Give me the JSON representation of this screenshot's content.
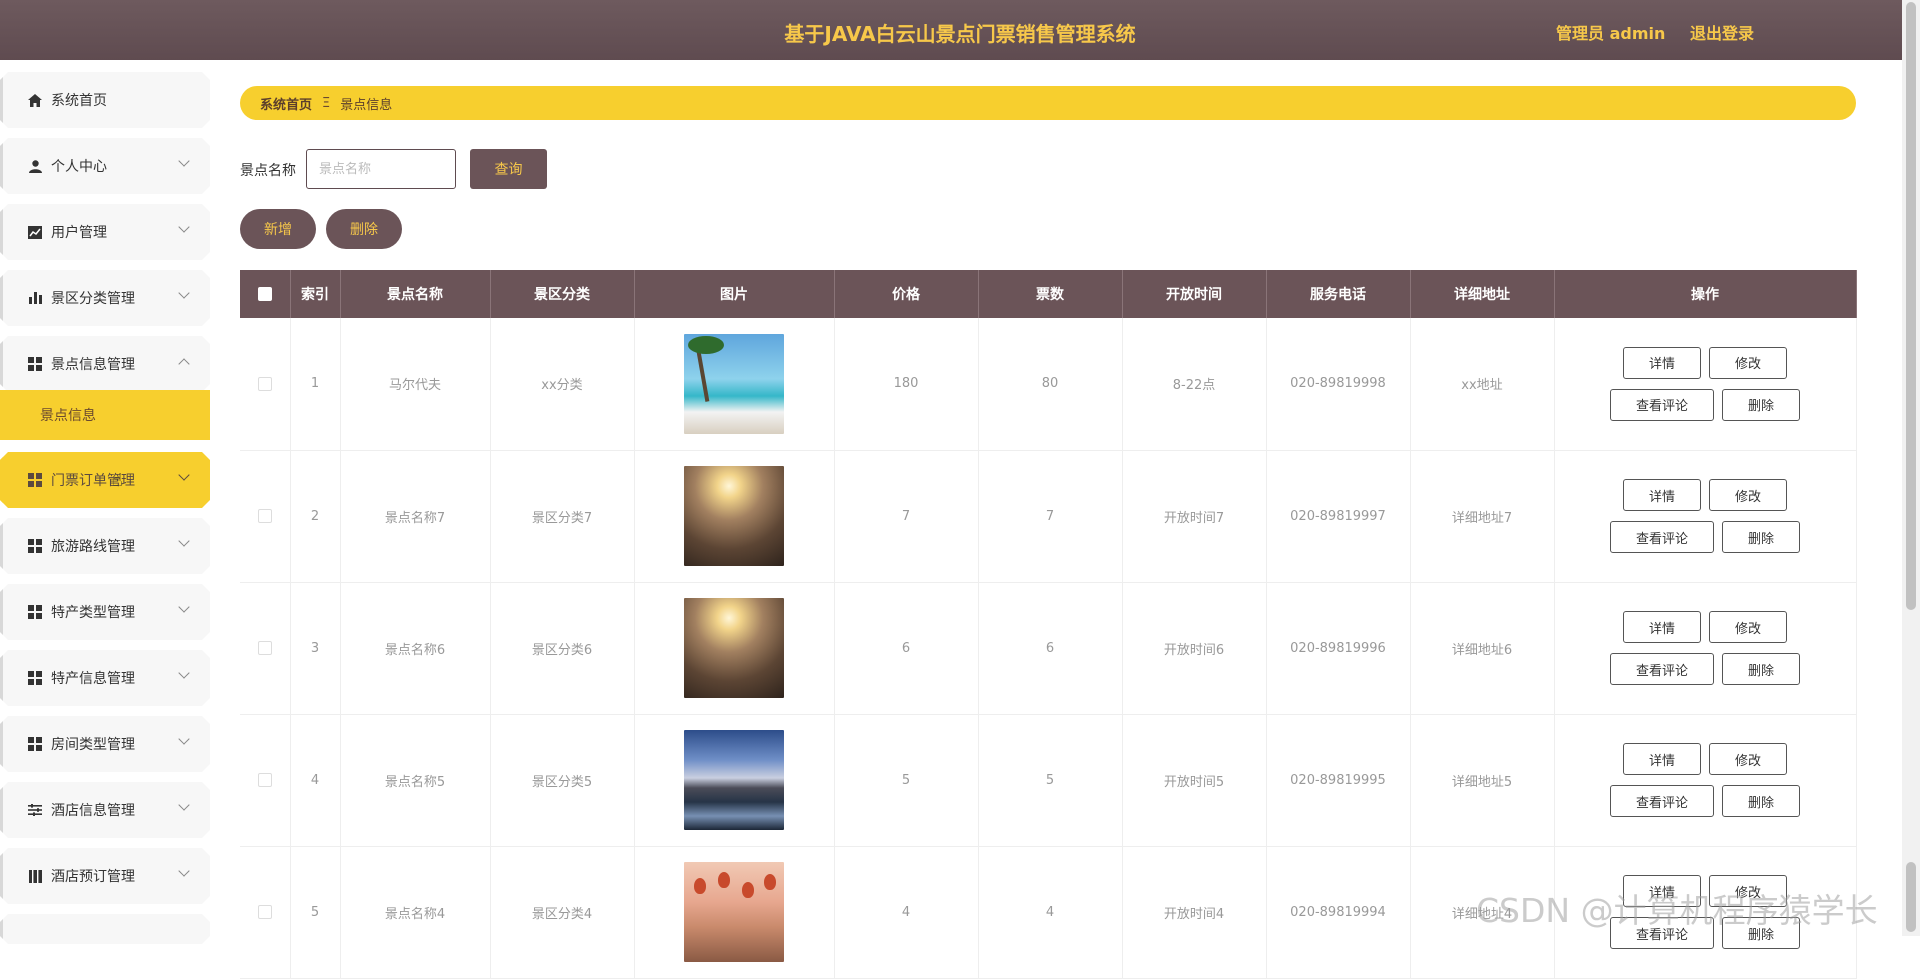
{
  "header": {
    "title": "基于JAVA白云山景点门票销售管理系统",
    "user": "管理员 admin",
    "logout": "退出登录"
  },
  "sidebar": {
    "items": [
      {
        "label": "系统首页",
        "icon": "home-icon"
      },
      {
        "label": "个人中心",
        "icon": "person-icon"
      },
      {
        "label": "用户管理",
        "icon": "chart-icon"
      },
      {
        "label": "景区分类管理",
        "icon": "bar-chart-icon"
      },
      {
        "label": "景点信息管理",
        "icon": "grid-icon"
      },
      {
        "label": "门票订单管理",
        "icon": "grid-icon"
      },
      {
        "label": "旅游路线管理",
        "icon": "grid-icon"
      },
      {
        "label": "特产类型管理",
        "icon": "grid-icon"
      },
      {
        "label": "特产信息管理",
        "icon": "grid-icon"
      },
      {
        "label": "房间类型管理",
        "icon": "grid-icon"
      },
      {
        "label": "酒店信息管理",
        "icon": "sliders-icon"
      },
      {
        "label": "酒店预订管理",
        "icon": "book-icon"
      }
    ],
    "sub_item": "景点信息"
  },
  "breadcrumb": {
    "home": "系统首页",
    "sep": "Ξ",
    "current": "景点信息"
  },
  "search": {
    "label": "景点名称",
    "placeholder": "景点名称",
    "query_button": "查询"
  },
  "actions": {
    "add": "新增",
    "delete": "删除"
  },
  "table": {
    "columns": [
      "索引",
      "景点名称",
      "景区分类",
      "图片",
      "价格",
      "票数",
      "开放时间",
      "服务电话",
      "详细地址",
      "操作"
    ],
    "rows": [
      {
        "index": "1",
        "name": "马尔代夫",
        "category": "xx分类",
        "image": "beach",
        "price": "180",
        "tickets": "80",
        "open": "8-22点",
        "phone": "020-89819998",
        "address": "xx地址"
      },
      {
        "index": "2",
        "name": "景点名称7",
        "category": "景区分类7",
        "image": "fog",
        "price": "7",
        "tickets": "7",
        "open": "开放时间7",
        "phone": "020-89819997",
        "address": "详细地址7"
      },
      {
        "index": "3",
        "name": "景点名称6",
        "category": "景区分类6",
        "image": "fog",
        "price": "6",
        "tickets": "6",
        "open": "开放时间6",
        "phone": "020-89819996",
        "address": "详细地址6"
      },
      {
        "index": "4",
        "name": "景点名称5",
        "category": "景区分类5",
        "image": "lake",
        "price": "5",
        "tickets": "5",
        "open": "开放时间5",
        "phone": "020-89819995",
        "address": "详细地址5"
      },
      {
        "index": "5",
        "name": "景点名称4",
        "category": "景区分类4",
        "image": "balloon",
        "price": "4",
        "tickets": "4",
        "open": "开放时间4",
        "phone": "020-89819994",
        "address": "详细地址4"
      }
    ],
    "ops": {
      "detail": "详情",
      "edit": "修改",
      "comments": "查看评论",
      "delete": "删除"
    }
  },
  "watermark": "CSDN @计算机程序猿学长",
  "colors": {
    "header": "#6b5458",
    "accent": "#f7cf2e",
    "accent_text": "#f7c84a"
  }
}
